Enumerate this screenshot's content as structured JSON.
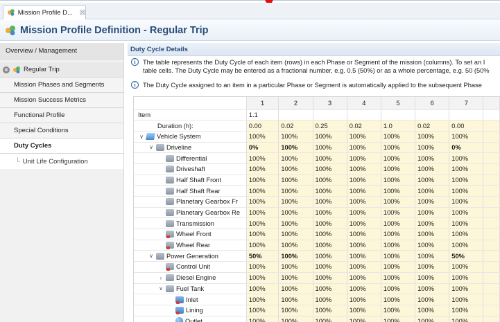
{
  "editor_tab": {
    "label": "Mission Profile D...",
    "close": "☒"
  },
  "page_title": "Mission Profile Definition - Regular Trip",
  "sidebar": {
    "items": [
      {
        "label": "Overview / Management"
      },
      {
        "label": "Regular Trip"
      },
      {
        "label": "Mission Phases and Segments"
      },
      {
        "label": "Mission Success Metrics"
      },
      {
        "label": "Functional Profile"
      },
      {
        "label": "Special Conditions"
      },
      {
        "label": "Duty Cycles"
      },
      {
        "label": "Unit Life Configuration"
      }
    ]
  },
  "section": {
    "title": "Duty Cycle Details",
    "info1_line1": "The table represents the Duty Cycle of each item (rows) in each Phase or Segment of the mission (columns). To set an I",
    "info1_line2": "table cells. The Duty Cycle may be entered as a fractional number, e.g. 0.5 (50%) or as a whole percentage, e.g. 50 (50%",
    "info2": "The Duty Cycle assigned to an item in a particular Phase or Segment is automatically applied to the subsequent Phase"
  },
  "grid": {
    "columns": [
      "1",
      "2",
      "3",
      "4",
      "5",
      "6",
      "7"
    ],
    "item_label": "Item",
    "item_first": "1.1",
    "duration_label": "Duration (h):",
    "durations": [
      "0.00",
      "0.02",
      "0.25",
      "0.02",
      "1.0",
      "0.02",
      "0.00"
    ],
    "rows": [
      {
        "label": "Vehicle System",
        "icon": "vehicle-system-icon",
        "caret": "∨",
        "level": 0,
        "values": [
          "100%",
          "100%",
          "100%",
          "100%",
          "100%",
          "100%",
          "100%"
        ]
      },
      {
        "label": "Driveline",
        "icon": "gear-icon",
        "caret": "∨",
        "level": 1,
        "values": [
          "0%",
          "100%",
          "100%",
          "100%",
          "100%",
          "100%",
          "0%"
        ],
        "bold": [
          0,
          1,
          6
        ]
      },
      {
        "label": "Differential",
        "icon": "gear-icon",
        "caret": "",
        "level": 2,
        "values": [
          "100%",
          "100%",
          "100%",
          "100%",
          "100%",
          "100%",
          "100%"
        ]
      },
      {
        "label": "Driveshaft",
        "icon": "gear-icon",
        "caret": "",
        "level": 2,
        "values": [
          "100%",
          "100%",
          "100%",
          "100%",
          "100%",
          "100%",
          "100%"
        ]
      },
      {
        "label": "Half Shaft Front",
        "icon": "gear-icon",
        "caret": "",
        "level": 2,
        "values": [
          "100%",
          "100%",
          "100%",
          "100%",
          "100%",
          "100%",
          "100%"
        ]
      },
      {
        "label": "Half Shaft Rear",
        "icon": "gear-icon",
        "caret": "",
        "level": 2,
        "values": [
          "100%",
          "100%",
          "100%",
          "100%",
          "100%",
          "100%",
          "100%"
        ]
      },
      {
        "label": "Planetary Gearbox Fr",
        "icon": "gear-icon",
        "caret": "",
        "level": 2,
        "values": [
          "100%",
          "100%",
          "100%",
          "100%",
          "100%",
          "100%",
          "100%"
        ]
      },
      {
        "label": "Planetary Gearbox Re",
        "icon": "gear-icon",
        "caret": "",
        "level": 2,
        "values": [
          "100%",
          "100%",
          "100%",
          "100%",
          "100%",
          "100%",
          "100%"
        ]
      },
      {
        "label": "Transmission",
        "icon": "gear-icon",
        "caret": "",
        "level": 2,
        "values": [
          "100%",
          "100%",
          "100%",
          "100%",
          "100%",
          "100%",
          "100%"
        ]
      },
      {
        "label": "Wheel Front",
        "icon": "gear-red-icon",
        "caret": "",
        "level": 2,
        "values": [
          "100%",
          "100%",
          "100%",
          "100%",
          "100%",
          "100%",
          "100%"
        ]
      },
      {
        "label": "Wheel Rear",
        "icon": "gear-red-icon",
        "caret": "",
        "level": 2,
        "values": [
          "100%",
          "100%",
          "100%",
          "100%",
          "100%",
          "100%",
          "100%"
        ]
      },
      {
        "label": "Power Generation",
        "icon": "gear-icon",
        "caret": "∨",
        "level": 1,
        "values": [
          "50%",
          "100%",
          "100%",
          "100%",
          "100%",
          "100%",
          "50%"
        ],
        "bold": [
          0,
          1,
          6
        ]
      },
      {
        "label": "Control Unit",
        "icon": "gear-red-icon",
        "caret": "",
        "level": 2,
        "values": [
          "100%",
          "100%",
          "100%",
          "100%",
          "100%",
          "100%",
          "100%"
        ]
      },
      {
        "label": "Diesel Engine",
        "icon": "gear-icon",
        "caret": "›",
        "level": 2,
        "values": [
          "100%",
          "100%",
          "100%",
          "100%",
          "100%",
          "100%",
          "100%"
        ]
      },
      {
        "label": "Fuel Tank",
        "icon": "gear-icon",
        "caret": "∨",
        "level": 2,
        "values": [
          "100%",
          "100%",
          "100%",
          "100%",
          "100%",
          "100%",
          "100%"
        ]
      },
      {
        "label": "Inlet",
        "icon": "gear-blue-red-icon",
        "caret": "",
        "level": 3,
        "values": [
          "100%",
          "100%",
          "100%",
          "100%",
          "100%",
          "100%",
          "100%"
        ]
      },
      {
        "label": "Lining",
        "icon": "gear-blue-red-icon",
        "caret": "",
        "level": 3,
        "values": [
          "100%",
          "100%",
          "100%",
          "100%",
          "100%",
          "100%",
          "100%"
        ]
      },
      {
        "label": "Outlet",
        "icon": "globe-icon",
        "caret": "",
        "level": 3,
        "values": [
          "100%",
          "100%",
          "100%",
          "100%",
          "100%",
          "100%",
          "100%"
        ]
      }
    ]
  },
  "colors": {
    "title": "#2a4d79",
    "value_cell": "#fdf6d8",
    "marker": "#e01010"
  }
}
